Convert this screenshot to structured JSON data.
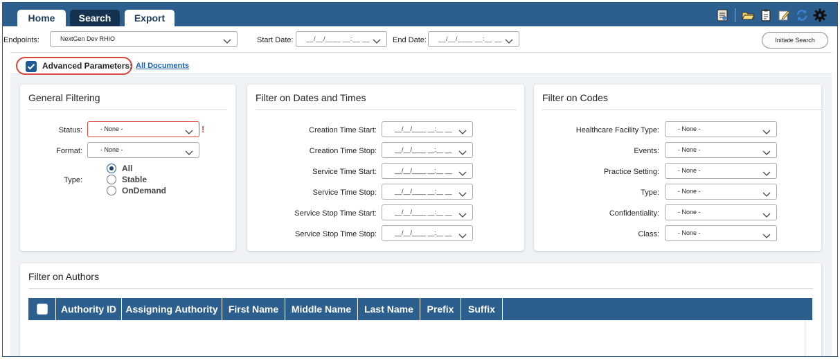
{
  "tabs": {
    "home": "Home",
    "search": "Search",
    "export": "Export"
  },
  "toolbar": {
    "icons": [
      "notes-icon",
      "folder-open-icon",
      "clipboard-icon",
      "edit-icon",
      "refresh-icon",
      "settings-gear-icon"
    ]
  },
  "top": {
    "endpoints_label": "Endpoints:",
    "endpoints_value": "NextGen Dev RHIO",
    "start_date_label": "Start Date:",
    "start_date_value": "__/__/____ __:__ __",
    "end_date_label": "End Date:",
    "end_date_value": "__/__/____ __:__ __",
    "initiate_search": "Initiate Search"
  },
  "advanced": {
    "checked": true,
    "label": "Advanced Parameters:",
    "link": "All Documents"
  },
  "general": {
    "title": "General Filtering",
    "status_label": "Status:",
    "status_value": "- None -",
    "status_error": "!",
    "format_label": "Format:",
    "format_value": "- None -",
    "type_label": "Type:",
    "type_options": [
      "All",
      "Stable",
      "OnDemand"
    ],
    "type_selected": "All"
  },
  "dates": {
    "title": "Filter on Dates and Times",
    "fields": [
      {
        "label": "Creation Time Start:",
        "value": "__/__/____ __:__ __"
      },
      {
        "label": "Creation Time Stop:",
        "value": "__/__/____ __:__ __"
      },
      {
        "label": "Service Time Start:",
        "value": "__/__/____ __:__ __"
      },
      {
        "label": "Service Time Stop:",
        "value": "__/__/____ __:__ __"
      },
      {
        "label": "Service Stop Time Start:",
        "value": "__/__/____ __:__ __"
      },
      {
        "label": "Service Stop Time Stop:",
        "value": "__/__/____ __:__ __"
      }
    ]
  },
  "codes": {
    "title": "Filter on Codes",
    "fields": [
      {
        "label": "Healthcare Facility Type:",
        "value": "- None -"
      },
      {
        "label": "Events:",
        "value": "- None -"
      },
      {
        "label": "Practice Setting:",
        "value": "- None -"
      },
      {
        "label": "Type:",
        "value": "- None -"
      },
      {
        "label": "Confidentiality:",
        "value": "- None -"
      },
      {
        "label": "Class:",
        "value": "- None -"
      }
    ]
  },
  "authors": {
    "title": "Filter on Authors",
    "columns": [
      "Authority ID",
      "Assigning Authority",
      "First Name",
      "Middle Name",
      "Last Name",
      "Prefix",
      "Suffix"
    ]
  },
  "colors": {
    "header_blue": "#2c5f8e",
    "accent_red": "#d9463c",
    "link_blue": "#1a5fb4"
  }
}
